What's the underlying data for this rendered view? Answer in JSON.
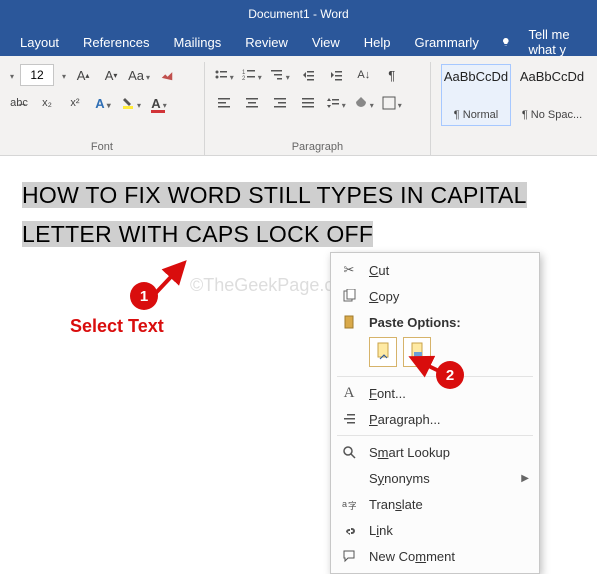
{
  "title": "Document1 - Word",
  "menu": {
    "layout": "Layout",
    "references": "References",
    "mailings": "Mailings",
    "review": "Review",
    "view": "View",
    "help": "Help",
    "grammarly": "Grammarly",
    "tellme": "Tell me what y"
  },
  "ribbon": {
    "font": {
      "size": "12",
      "label": "Font"
    },
    "paragraph": {
      "label": "Paragraph"
    },
    "styles": {
      "normal": {
        "preview": "AaBbCcDd",
        "label": "¶ Normal"
      },
      "nospace": {
        "preview": "AaBbCcDd",
        "label": "¶ No Spac..."
      }
    }
  },
  "document": {
    "text": "HOW TO FIX WORD STILL TYPES IN CAPITAL LETTER WITH CAPS LOCK OFF",
    "watermark": "©TheGeekPage.com"
  },
  "annotations": {
    "one": "1",
    "two": "2",
    "selectText": "Select Text"
  },
  "context": {
    "cut": "Cut",
    "copy": "Copy",
    "pasteOptions": "Paste Options:",
    "font": "Font...",
    "paragraph": "Paragraph...",
    "smartLookup": "Smart Lookup",
    "synonyms": "Synonyms",
    "translate": "Translate",
    "link": "Link",
    "newComment": "New Comment"
  }
}
